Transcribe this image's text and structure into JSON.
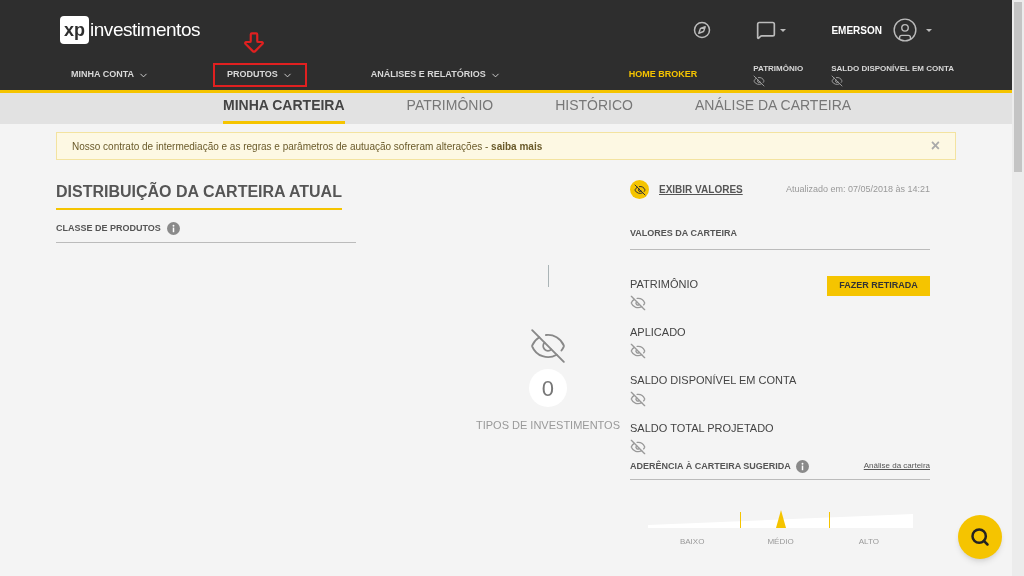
{
  "header": {
    "logo": {
      "mark": "xp",
      "name": "investimentos"
    },
    "user": "EMERSON"
  },
  "nav": {
    "items": [
      {
        "label": "MINHA CONTA",
        "kind": "menu",
        "highlighted": false
      },
      {
        "label": "PRODUTOS",
        "kind": "menu",
        "highlighted": true
      },
      {
        "label": "ANÁLISES E RELATÓRIOS",
        "kind": "menu",
        "highlighted": false
      },
      {
        "label": "HOME BROKER",
        "kind": "link",
        "highlighted": false
      }
    ],
    "balances": [
      {
        "label": "PATRIMÔNIO"
      },
      {
        "label": "SALDO DISPONÍVEL EM CONTA"
      }
    ]
  },
  "tabs": [
    {
      "label": "MINHA CARTEIRA",
      "selected": true
    },
    {
      "label": "PATRIMÔNIO",
      "selected": false
    },
    {
      "label": "HISTÓRICO",
      "selected": false
    },
    {
      "label": "ANÁLISE DA CARTEIRA",
      "selected": false
    }
  ],
  "notice": {
    "text": "Nosso contrato de intermediação e as regras e parâmetros de autuação sofreram alterações - **saiba mais**",
    "close": "×"
  },
  "distribution": {
    "title": "DISTRIBUIÇÃO DA CARTEIRA ATUAL",
    "section": "CLASSE DE PRODUTOS",
    "count": "0",
    "count_label": "TIPOS DE INVESTIMENTOS"
  },
  "values": {
    "toggle": "EXIBIR VALORES",
    "updated": "Atualizado em: 07/05/2018 às 14:21",
    "section": "VALORES DA CARTEIRA",
    "withdraw_button": "FAZER RETIRADA",
    "items": [
      {
        "label": "PATRIMÔNIO"
      },
      {
        "label": "APLICADO"
      },
      {
        "label": "SALDO DISPONÍVEL EM CONTA"
      },
      {
        "label": "SALDO TOTAL PROJETADO"
      }
    ]
  },
  "adherence": {
    "title": "ADERÊNCIA À CARTEIRA SUGERIDA",
    "link": "Análise da carteira",
    "level": 0.5,
    "scale": [
      "BAIXO",
      "MÉDIO",
      "ALTO"
    ]
  }
}
